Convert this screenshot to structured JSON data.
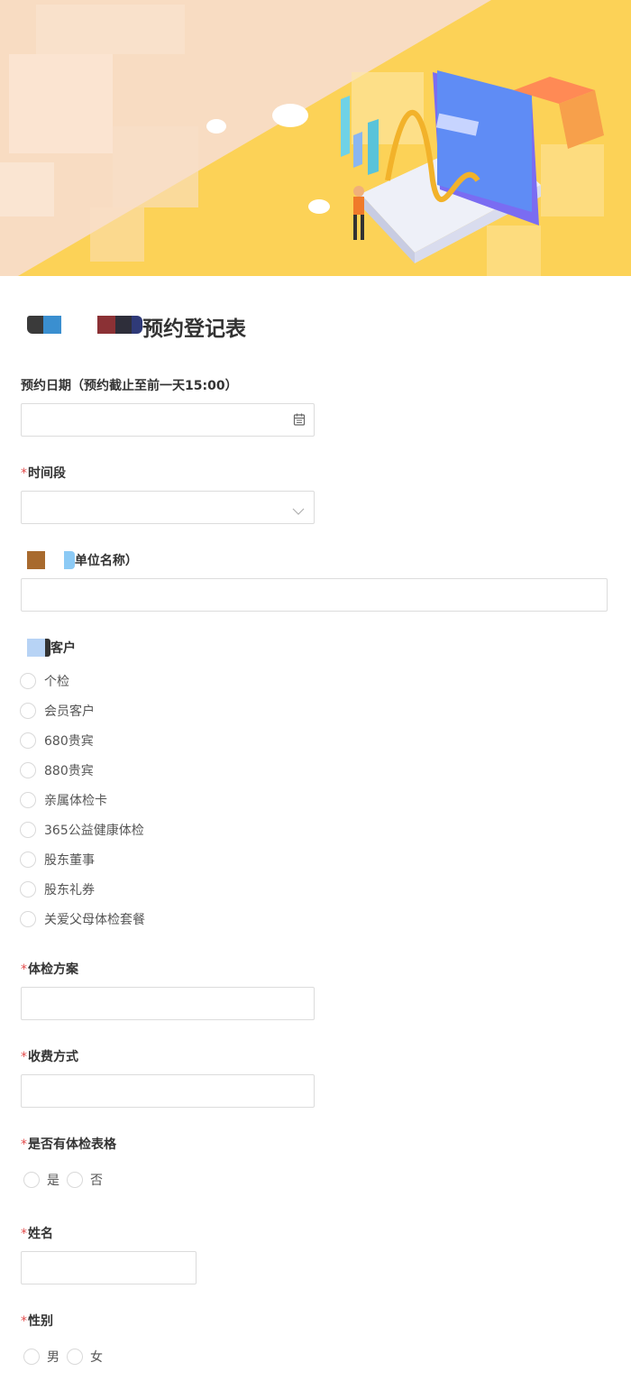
{
  "form": {
    "title": "预约登记表"
  },
  "questions": {
    "date": {
      "label": "预约日期（预约截止至前一天15:00）",
      "value": "",
      "icon": "calendar-icon"
    },
    "time_slot": {
      "required_mark": "*",
      "label": "时间段",
      "value": "",
      "icon": "chevron-down-icon"
    },
    "company": {
      "label": "单位名称）",
      "value": ""
    },
    "customer": {
      "label": "客户",
      "options": [
        "个检",
        "会员客户",
        "680贵宾",
        "880贵宾",
        "亲属体检卡",
        "365公益健康体检",
        "股东董事",
        "股东礼券",
        "关爱父母体检套餐"
      ]
    },
    "plan": {
      "required_mark": "*",
      "label": "体检方案",
      "value": ""
    },
    "payment": {
      "required_mark": "*",
      "label": "收费方式",
      "value": ""
    },
    "has_form": {
      "required_mark": "*",
      "label": "是否有体检表格",
      "options": [
        "是",
        "否"
      ]
    },
    "name": {
      "required_mark": "*",
      "label": "姓名",
      "value": ""
    },
    "gender": {
      "required_mark": "*",
      "label": "性别",
      "options": [
        "男",
        "女"
      ]
    }
  },
  "colors": {
    "banner_yellow": "#fcd257",
    "required": "#e24a4a",
    "border": "#dcdcdc"
  }
}
